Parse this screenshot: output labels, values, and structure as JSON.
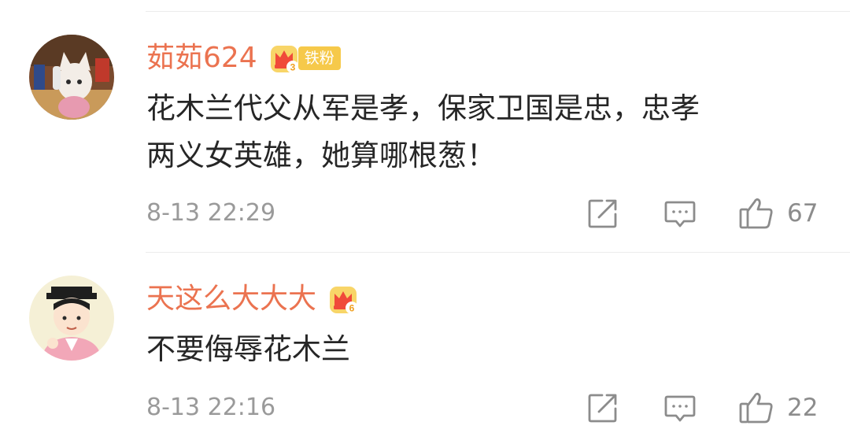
{
  "comments": [
    {
      "username": "茹茹624",
      "vip_level": "3",
      "fan_tag": "铁粉",
      "text": "花木兰代父从军是孝，保家卫国是忠，忠孝\n两义女英雄，她算哪根葱！",
      "timestamp": "8-13 22:29",
      "likes": "67",
      "icons": [
        "share-icon",
        "comment-icon",
        "like-icon"
      ]
    },
    {
      "username": "天这么大大大",
      "vip_level": "6",
      "fan_tag": "",
      "text": "不要侮辱花木兰",
      "timestamp": "8-13 22:16",
      "likes": "22",
      "icons": [
        "share-icon",
        "comment-icon",
        "like-icon"
      ]
    }
  ],
  "colors": {
    "username": "#eb7350",
    "text": "#262626",
    "meta": "#9a9a9a",
    "badge": "#f6c94a"
  }
}
